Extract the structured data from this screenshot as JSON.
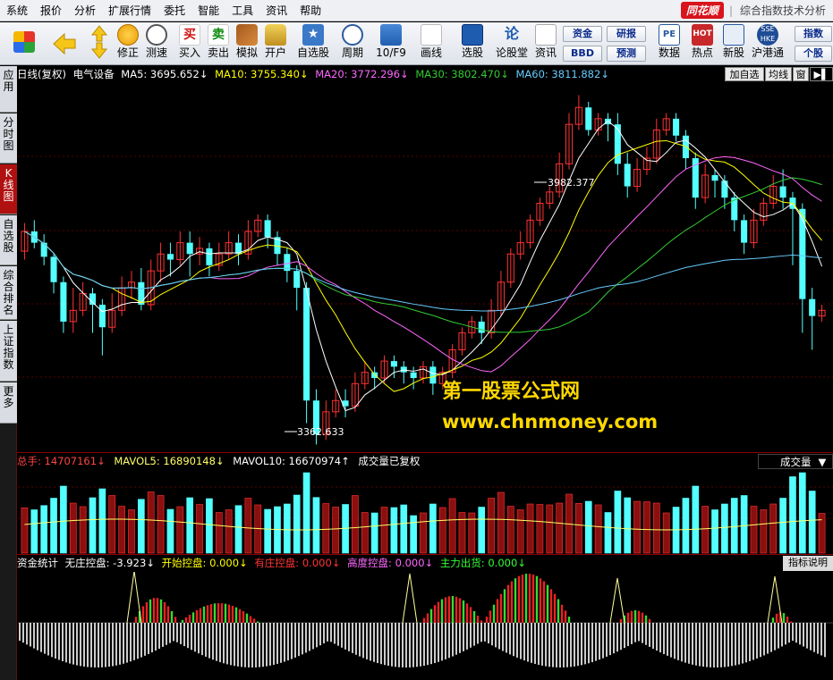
{
  "menu": {
    "items": [
      "系统",
      "报价",
      "分析",
      "扩展行情",
      "委托",
      "智能",
      "工具",
      "资讯",
      "帮助"
    ],
    "brand": "同花顺",
    "title": "综合指数技术分析"
  },
  "toolbar": {
    "buttons": [
      {
        "label": "",
        "icon": "windows-icon"
      },
      {
        "label": "",
        "icon": "back-arrow-icon"
      },
      {
        "label": "",
        "icon": "up-down-arrows-icon"
      },
      {
        "label": "修正",
        "icon": "clock-coin-icon"
      },
      {
        "label": "测速",
        "icon": "clock-icon"
      },
      {
        "label": "买入",
        "icon": "buy-icon"
      },
      {
        "label": "卖出",
        "icon": "sell-icon"
      },
      {
        "label": "模拟",
        "icon": "gavel-icon"
      },
      {
        "label": "开户",
        "icon": "lock-icon"
      },
      {
        "label": "自选股",
        "icon": "star-list-icon"
      },
      {
        "label": "周期",
        "icon": "clock-cycle-icon"
      },
      {
        "label": "10/F9",
        "icon": "f10-icon"
      },
      {
        "label": "画线",
        "icon": "pencil-icon"
      },
      {
        "label": "选股",
        "icon": "stock-picker-icon"
      },
      {
        "label": "论股堂",
        "icon": "forum-icon"
      },
      {
        "label": "资讯",
        "icon": "news-icon"
      },
      {
        "label": "数据",
        "icon": "pe-data-icon"
      },
      {
        "label": "热点",
        "icon": "hot-icon"
      },
      {
        "label": "新股",
        "icon": "ipo-icon"
      },
      {
        "label": "沪港通",
        "icon": "sse-hke-icon"
      }
    ],
    "small_buttons": [
      "资金",
      "BBD",
      "研报",
      "预测",
      "指数",
      "个股"
    ]
  },
  "side_tabs": [
    {
      "label": "应用",
      "active": false
    },
    {
      "label": "分时图",
      "active": false
    },
    {
      "label": "K线图",
      "active": true
    },
    {
      "label": "自选股",
      "active": false
    },
    {
      "label": "综合排名",
      "active": false
    },
    {
      "label": "上证指数",
      "active": false
    },
    {
      "label": "更多",
      "active": false
    }
  ],
  "price_header": {
    "period": "日线(复权)",
    "name": "电气设备",
    "ma": [
      {
        "text": "MA5: 3695.652↓",
        "color": "#ffffff"
      },
      {
        "text": "MA10: 3755.340↓",
        "color": "#ffff00"
      },
      {
        "text": "MA20: 3772.296↓",
        "color": "#ff66ff"
      },
      {
        "text": "MA30: 3802.470↓",
        "color": "#33cc33"
      },
      {
        "text": "MA60: 3811.882↓",
        "color": "#66ccff"
      }
    ],
    "right_buttons": [
      "加自选",
      "均线",
      "窗"
    ]
  },
  "volume_header": {
    "items": [
      {
        "text": "总手: 14707161↓",
        "color": "#ff4444"
      },
      {
        "text": "MAVOL5: 16890148↓",
        "color": "#ffff66"
      },
      {
        "text": "MAVOL10: 16670974↑",
        "color": "#ffffff"
      },
      {
        "text": "成交量已复权",
        "color": "#ffffff"
      }
    ],
    "dropdown": "成交量"
  },
  "capital_header": {
    "items": [
      {
        "text": "资金统计",
        "color": "#ffffff"
      },
      {
        "text": "无庄控盘: -3.923↓",
        "color": "#ffffff"
      },
      {
        "text": "开始控盘: 0.000↓",
        "color": "#ffff00"
      },
      {
        "text": "有庄控盘: 0.000↓",
        "color": "#ff3333"
      },
      {
        "text": "高度控盘: 0.000↓",
        "color": "#ff66ff"
      },
      {
        "text": "主力出货: 0.000↓",
        "color": "#33ff33"
      }
    ],
    "help": "指标说明"
  },
  "annotations": {
    "high": "3982.377",
    "low": "3362.633"
  },
  "watermark": {
    "line1": "第一股票公式网",
    "line2": "www.chnmoney.com"
  },
  "colors": {
    "up": "#ff3232",
    "down": "#54ffff",
    "ma5": "#ffffff",
    "ma10": "#ffff00",
    "ma20": "#ff66ff",
    "ma30": "#33cc33",
    "ma60": "#66ccff"
  },
  "chart_data": {
    "type": "candlestick",
    "price_scale": [
      3350,
      4000
    ],
    "candles": [
      [
        3705,
        3740,
        3690,
        3755
      ],
      [
        3740,
        3720,
        3710,
        3760
      ],
      [
        3720,
        3695,
        3680,
        3735
      ],
      [
        3695,
        3650,
        3630,
        3700
      ],
      [
        3650,
        3580,
        3560,
        3660
      ],
      [
        3580,
        3600,
        3560,
        3640
      ],
      [
        3600,
        3630,
        3590,
        3650
      ],
      [
        3630,
        3610,
        3560,
        3640
      ],
      [
        3610,
        3570,
        3520,
        3620
      ],
      [
        3570,
        3600,
        3560,
        3630
      ],
      [
        3600,
        3640,
        3590,
        3660
      ],
      [
        3640,
        3650,
        3620,
        3670
      ],
      [
        3650,
        3610,
        3600,
        3675
      ],
      [
        3610,
        3670,
        3600,
        3690
      ],
      [
        3670,
        3700,
        3650,
        3720
      ],
      [
        3700,
        3690,
        3660,
        3720
      ],
      [
        3690,
        3720,
        3680,
        3740
      ],
      [
        3720,
        3700,
        3660,
        3740
      ],
      [
        3700,
        3710,
        3680,
        3730
      ],
      [
        3710,
        3680,
        3660,
        3720
      ],
      [
        3680,
        3700,
        3670,
        3720
      ],
      [
        3700,
        3720,
        3690,
        3740
      ],
      [
        3720,
        3700,
        3680,
        3735
      ],
      [
        3700,
        3740,
        3690,
        3760
      ],
      [
        3740,
        3760,
        3730,
        3770
      ],
      [
        3760,
        3730,
        3710,
        3770
      ],
      [
        3730,
        3700,
        3680,
        3740
      ],
      [
        3700,
        3670,
        3650,
        3710
      ],
      [
        3670,
        3640,
        3600,
        3680
      ],
      [
        3640,
        3440,
        3400,
        3650
      ],
      [
        3440,
        3380,
        3362,
        3460
      ],
      [
        3380,
        3420,
        3370,
        3440
      ],
      [
        3420,
        3440,
        3410,
        3460
      ],
      [
        3440,
        3430,
        3410,
        3460
      ],
      [
        3430,
        3470,
        3420,
        3490
      ],
      [
        3470,
        3490,
        3460,
        3510
      ],
      [
        3490,
        3480,
        3460,
        3500
      ],
      [
        3480,
        3510,
        3470,
        3520
      ],
      [
        3510,
        3500,
        3480,
        3520
      ],
      [
        3500,
        3490,
        3470,
        3510
      ],
      [
        3490,
        3480,
        3460,
        3500
      ],
      [
        3480,
        3500,
        3470,
        3510
      ],
      [
        3500,
        3470,
        3450,
        3510
      ],
      [
        3470,
        3490,
        3460,
        3500
      ],
      [
        3490,
        3530,
        3480,
        3540
      ],
      [
        3530,
        3560,
        3520,
        3570
      ],
      [
        3560,
        3580,
        3550,
        3590
      ],
      [
        3580,
        3560,
        3540,
        3590
      ],
      [
        3560,
        3600,
        3550,
        3620
      ],
      [
        3600,
        3650,
        3590,
        3670
      ],
      [
        3650,
        3700,
        3640,
        3710
      ],
      [
        3700,
        3720,
        3690,
        3740
      ],
      [
        3720,
        3760,
        3710,
        3770
      ],
      [
        3760,
        3790,
        3750,
        3800
      ],
      [
        3790,
        3810,
        3780,
        3820
      ],
      [
        3810,
        3860,
        3800,
        3880
      ],
      [
        3860,
        3930,
        3850,
        3950
      ],
      [
        3930,
        3960,
        3920,
        3982
      ],
      [
        3960,
        3920,
        3910,
        3970
      ],
      [
        3920,
        3940,
        3910,
        3950
      ],
      [
        3940,
        3930,
        3900,
        3950
      ],
      [
        3930,
        3860,
        3840,
        3950
      ],
      [
        3860,
        3820,
        3800,
        3880
      ],
      [
        3820,
        3850,
        3810,
        3870
      ],
      [
        3850,
        3870,
        3840,
        3890
      ],
      [
        3870,
        3920,
        3860,
        3940
      ],
      [
        3920,
        3940,
        3910,
        3950
      ],
      [
        3940,
        3910,
        3900,
        3950
      ],
      [
        3910,
        3870,
        3850,
        3920
      ],
      [
        3870,
        3800,
        3780,
        3880
      ],
      [
        3800,
        3840,
        3790,
        3860
      ],
      [
        3840,
        3830,
        3800,
        3850
      ],
      [
        3830,
        3800,
        3780,
        3840
      ],
      [
        3800,
        3760,
        3740,
        3810
      ],
      [
        3760,
        3720,
        3700,
        3770
      ],
      [
        3720,
        3760,
        3710,
        3780
      ],
      [
        3760,
        3790,
        3750,
        3800
      ],
      [
        3790,
        3820,
        3780,
        3840
      ],
      [
        3820,
        3800,
        3780,
        3850
      ],
      [
        3800,
        3780,
        3680,
        3810
      ],
      [
        3780,
        3620,
        3560,
        3790
      ],
      [
        3620,
        3590,
        3530,
        3640
      ],
      [
        3590,
        3600,
        3580,
        3610
      ]
    ]
  }
}
